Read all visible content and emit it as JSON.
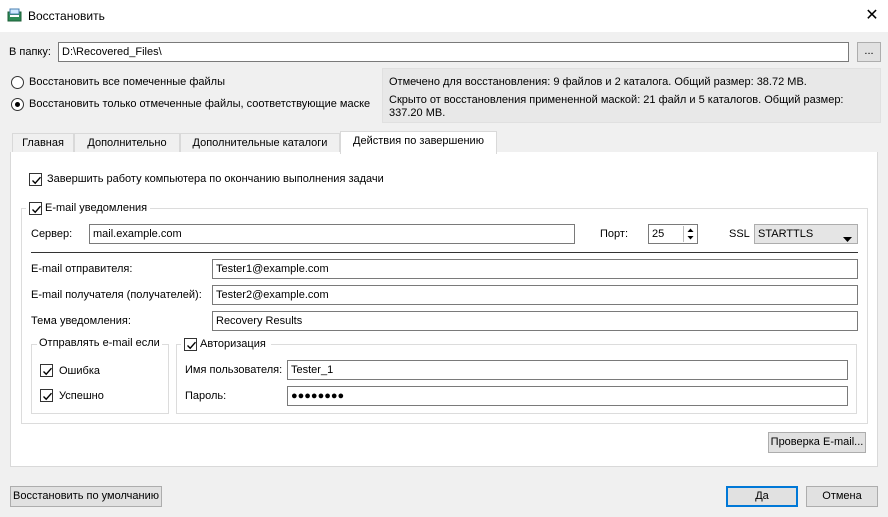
{
  "window": {
    "title": "Восстановить",
    "close_glyph": "✕"
  },
  "folder": {
    "label": "В папку:",
    "value": "D:\\Recovered_Files\\",
    "browse_label": "..."
  },
  "scope": {
    "option_all": "Восстановить все помеченные файлы",
    "option_masked": "Восстановить только отмеченные файлы, соответствующие маске",
    "selected": "masked"
  },
  "info": {
    "marked": "Отмечено для восстановления: 9 файлов и 2 каталога. Общий размер: 38.72 MB.",
    "hidden_line1": "Скрыто от восстановления примененной маской: 21 файл и 5 каталогов. Общий размер:",
    "hidden_line2": "337.20 MB."
  },
  "tabs": [
    {
      "label": "Главная"
    },
    {
      "label": "Дополнительно"
    },
    {
      "label": "Дополнительные каталоги"
    },
    {
      "label": "Действия по завершению",
      "active": true
    }
  ],
  "shutdown": {
    "label": "Завершить работу компьютера по окончанию выполнения задачи",
    "checked": true
  },
  "email": {
    "group_label": "E-mail уведомления",
    "enabled": true,
    "server_label": "Сервер:",
    "server_value": "mail.example.com",
    "port_label": "Порт:",
    "port_value": "25",
    "ssl_label": "SSL",
    "ssl_value": "STARTTLS",
    "sender_label": "E-mail отправителя:",
    "sender_value": "Tester1@example.com",
    "recipient_label": "E-mail получателя (получателей):",
    "recipient_value": "Tester2@example.com",
    "subject_label": "Тема уведомления:",
    "subject_value": "Recovery Results",
    "send_if_label": "Отправлять e-mail если",
    "on_error_label": "Ошибка",
    "on_error_checked": true,
    "on_success_label": "Успешно",
    "on_success_checked": true,
    "auth_label": "Авторизация",
    "auth_checked": true,
    "username_label": "Имя пользователя:",
    "username_value": "Tester_1",
    "password_label": "Пароль:",
    "password_value": "●●●●●●●●",
    "test_button": "Проверка E-mail..."
  },
  "footer": {
    "defaults_button": "Восстановить по умолчанию",
    "ok_button": "Да",
    "cancel_button": "Отмена"
  },
  "icons": {
    "app": "app-recovery-icon",
    "close": "close-icon",
    "spin": "spin-arrows-icon",
    "dropdown": "dropdown-arrow-icon",
    "check": "checkmark-icon"
  },
  "colors": {
    "accent": "#0078d7",
    "window_bg": "#f0f0f0",
    "panel_bg": "#ffffff"
  }
}
